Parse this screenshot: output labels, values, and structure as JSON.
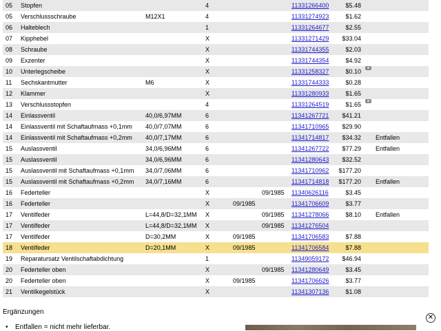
{
  "rows": [
    {
      "pos": "05",
      "desc": "Stopfen",
      "add": "",
      "qty": "4",
      "from": "",
      "to": "",
      "part": "11331266400",
      "price": "$5.48",
      "note": "",
      "photo": false
    },
    {
      "pos": "05",
      "desc": "Verschlussschraube",
      "add": "M12X1",
      "qty": "4",
      "from": "",
      "to": "",
      "part": "11331274923",
      "price": "$1.62",
      "note": "",
      "photo": false
    },
    {
      "pos": "06",
      "desc": "Halteblech",
      "add": "",
      "qty": "1",
      "from": "",
      "to": "",
      "part": "11331264677",
      "price": "$2.55",
      "note": "",
      "photo": false
    },
    {
      "pos": "07",
      "desc": "Kipphebel",
      "add": "",
      "qty": "X",
      "from": "",
      "to": "",
      "part": "11331271429",
      "price": "$33.04",
      "note": "",
      "photo": false
    },
    {
      "pos": "08",
      "desc": "Schraube",
      "add": "",
      "qty": "X",
      "from": "",
      "to": "",
      "part": "11331744355",
      "price": "$2.03",
      "note": "",
      "photo": false
    },
    {
      "pos": "09",
      "desc": "Exzenter",
      "add": "",
      "qty": "X",
      "from": "",
      "to": "",
      "part": "11331744354",
      "price": "$4.92",
      "note": "",
      "photo": false
    },
    {
      "pos": "10",
      "desc": "Unterlegscheibe",
      "add": "",
      "qty": "X",
      "from": "",
      "to": "",
      "part": "11331258327",
      "price": "$0.10",
      "note": "",
      "photo": true
    },
    {
      "pos": "11",
      "desc": "Sechskantmutter",
      "add": "M6",
      "qty": "X",
      "from": "",
      "to": "",
      "part": "11331744333",
      "price": "$0.28",
      "note": "",
      "photo": false
    },
    {
      "pos": "12",
      "desc": "Klammer",
      "add": "",
      "qty": "X",
      "from": "",
      "to": "",
      "part": "11331280933",
      "price": "$1.65",
      "note": "",
      "photo": false
    },
    {
      "pos": "13",
      "desc": "Verschlussstopfen",
      "add": "",
      "qty": "4",
      "from": "",
      "to": "",
      "part": "11331264519",
      "price": "$1.65",
      "note": "",
      "photo": true
    },
    {
      "pos": "14",
      "desc": "Einlassventil",
      "add": "40,0/6,97MM",
      "qty": "6",
      "from": "",
      "to": "",
      "part": "11341267721",
      "price": "$41.21",
      "note": "",
      "photo": false
    },
    {
      "pos": "14",
      "desc": "Einlassventil mit Schaftaufmass +0,1mm",
      "add": "40,0/7,07MM",
      "qty": "6",
      "from": "",
      "to": "",
      "part": "11341710965",
      "price": "$29.90",
      "note": "",
      "photo": false
    },
    {
      "pos": "14",
      "desc": "Einlassventil mit Schaftaufmass +0,2mm",
      "add": "40,0/7,17MM",
      "qty": "6",
      "from": "",
      "to": "",
      "part": "11341714817",
      "price": "$34.32",
      "note": "Entfallen",
      "photo": false
    },
    {
      "pos": "15",
      "desc": "Auslassventil",
      "add": "34,0/6,96MM",
      "qty": "6",
      "from": "",
      "to": "",
      "part": "11341267722",
      "price": "$77.29",
      "note": "Entfallen",
      "photo": false
    },
    {
      "pos": "15",
      "desc": "Auslassventil",
      "add": "34,0/6,96MM",
      "qty": "6",
      "from": "",
      "to": "",
      "part": "11341280643",
      "price": "$32.52",
      "note": "",
      "photo": false
    },
    {
      "pos": "15",
      "desc": "Auslassventil mit Schaftaufmass +0,1mm",
      "add": "34,0/7,06MM",
      "qty": "6",
      "from": "",
      "to": "",
      "part": "11341710962",
      "price": "$177.20",
      "note": "",
      "photo": false
    },
    {
      "pos": "15",
      "desc": "Auslassventil mit Schaftaufmass +0,2mm",
      "add": "34,0/7,16MM",
      "qty": "6",
      "from": "",
      "to": "",
      "part": "11341714818",
      "price": "$177.20",
      "note": "Entfallen",
      "photo": false
    },
    {
      "pos": "16",
      "desc": "Federteller",
      "add": "",
      "qty": "X",
      "from": "",
      "to": "09/1985",
      "part": "11340626116",
      "price": "$3.45",
      "note": "",
      "photo": false
    },
    {
      "pos": "16",
      "desc": "Federteller",
      "add": "",
      "qty": "X",
      "from": "09/1985",
      "to": "",
      "part": "11341706609",
      "price": "$3.77",
      "note": "",
      "photo": false
    },
    {
      "pos": "17",
      "desc": "Ventilfeder",
      "add": "L=44,8/D=32,1MM",
      "qty": "X",
      "from": "",
      "to": "09/1985",
      "part": "11341278066",
      "price": "$8.10",
      "note": "Entfallen",
      "photo": false
    },
    {
      "pos": "17",
      "desc": "Ventilfeder",
      "add": "L=44,8/D=32,1MM",
      "qty": "X",
      "from": "",
      "to": "09/1985",
      "part": "11341276504",
      "price": "",
      "note": "",
      "photo": false
    },
    {
      "pos": "17",
      "desc": "Ventilfeder",
      "add": "D=30,2MM",
      "qty": "X",
      "from": "09/1985",
      "to": "",
      "part": "11341706583",
      "price": "$7.88",
      "note": "",
      "photo": false
    },
    {
      "pos": "18",
      "desc": "Ventilfeder",
      "add": "D=20,1MM",
      "qty": "X",
      "from": "09/1985",
      "to": "",
      "part": "11341706584",
      "price": "$7.88",
      "note": "",
      "photo": false,
      "highlight": true
    },
    {
      "pos": "19",
      "desc": "Reparatursatz Ventilschaftabdichtung",
      "add": "",
      "qty": "1",
      "from": "",
      "to": "",
      "part": "11349059172",
      "price": "$46.94",
      "note": "",
      "photo": false
    },
    {
      "pos": "20",
      "desc": "Federteller oben",
      "add": "",
      "qty": "X",
      "from": "",
      "to": "09/1985",
      "part": "11341280649",
      "price": "$3.45",
      "note": "",
      "photo": false
    },
    {
      "pos": "20",
      "desc": "Federteller oben",
      "add": "",
      "qty": "X",
      "from": "09/1985",
      "to": "",
      "part": "11341706626",
      "price": "$3.77",
      "note": "",
      "photo": false
    },
    {
      "pos": "21",
      "desc": "Ventilkegelstück",
      "add": "",
      "qty": "X",
      "from": "",
      "to": "",
      "part": "11341307136",
      "price": "$1.08",
      "note": "",
      "photo": false
    }
  ],
  "supplements": {
    "title": "Ergänzungen",
    "items": [
      "Entfallen = nicht mehr lieferbar."
    ]
  },
  "close_label": "✕",
  "colors": {
    "row_even": "#e8e8e8",
    "row_odd": "#ffffff",
    "highlight": "#f6e08f",
    "link": "#1a1acc"
  }
}
